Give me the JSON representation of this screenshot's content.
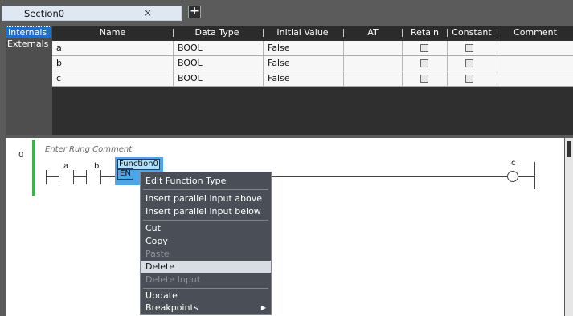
{
  "tabs": {
    "active_label": "Section0",
    "close_glyph": "×",
    "add_glyph": "+"
  },
  "scopes": [
    "Internals",
    "Externals"
  ],
  "table": {
    "columns": [
      "Name",
      "Data Type",
      "Initial Value",
      "AT",
      "Retain",
      "Constant",
      "Comment"
    ],
    "rows": [
      {
        "name": "a",
        "data_type": "BOOL",
        "initial_value": "False",
        "at": "",
        "retain": false,
        "constant": false,
        "comment": ""
      },
      {
        "name": "b",
        "data_type": "BOOL",
        "initial_value": "False",
        "at": "",
        "retain": false,
        "constant": false,
        "comment": ""
      },
      {
        "name": "c",
        "data_type": "BOOL",
        "initial_value": "False",
        "at": "",
        "retain": false,
        "constant": false,
        "comment": ""
      }
    ]
  },
  "ladder": {
    "rung_number": "0",
    "rung_comment_placeholder": "Enter Rung Comment",
    "contacts": [
      "a",
      "b"
    ],
    "function_block": {
      "name": "Function0",
      "input": "EN"
    },
    "coil": "c"
  },
  "context_menu": {
    "items": [
      {
        "label": "Edit Function Type",
        "enabled": true
      },
      {
        "label": "Insert parallel input above",
        "enabled": true
      },
      {
        "label": "Insert parallel input below",
        "enabled": true
      },
      {
        "label": "Cut",
        "enabled": true
      },
      {
        "label": "Copy",
        "enabled": true
      },
      {
        "label": "Paste",
        "enabled": false
      },
      {
        "label": "Delete",
        "enabled": true,
        "highlighted": true
      },
      {
        "label": "Delete Input",
        "enabled": false
      },
      {
        "label": "Update",
        "enabled": true
      },
      {
        "label": "Breakpoints",
        "enabled": true,
        "submenu": true
      }
    ]
  }
}
